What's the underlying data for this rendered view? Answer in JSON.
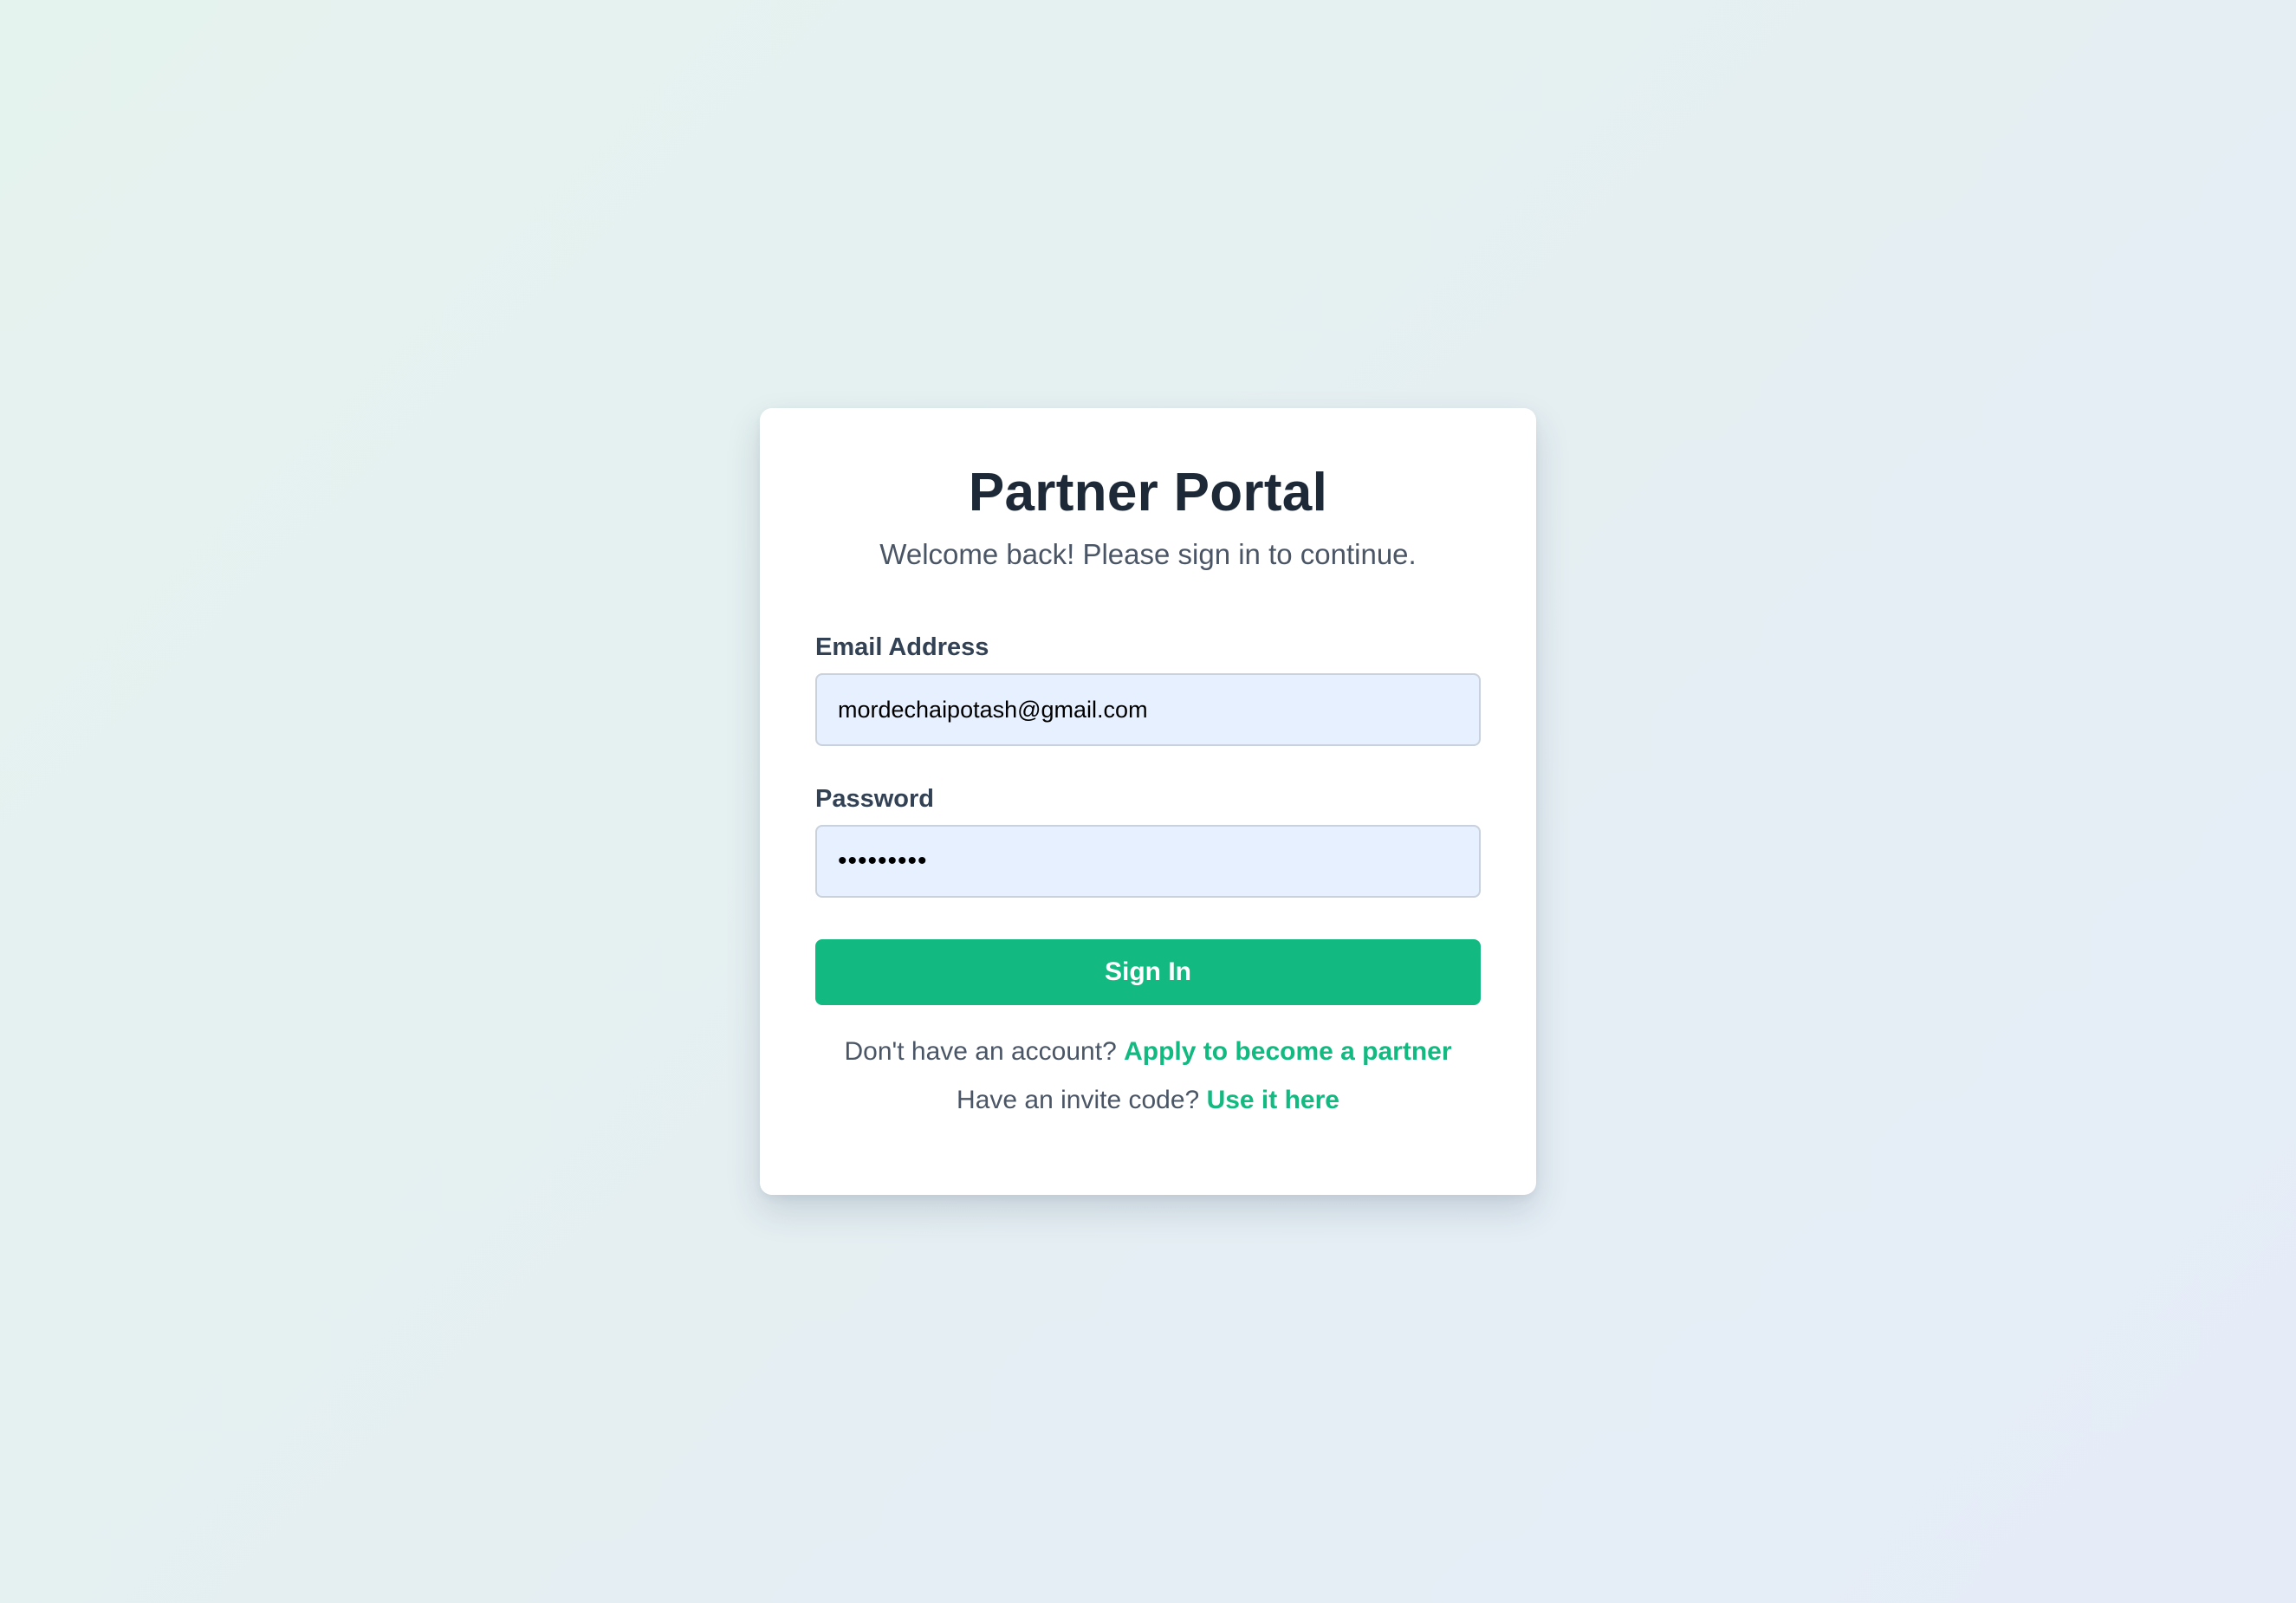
{
  "login": {
    "title": "Partner Portal",
    "subtitle": "Welcome back! Please sign in to continue.",
    "email": {
      "label": "Email Address",
      "value": "mordechaipotash@gmail.com"
    },
    "password": {
      "label": "Password",
      "masked_value": "•••••••••"
    },
    "signin_label": "Sign In",
    "apply": {
      "prompt": "Don't have an account?",
      "link": "Apply to become a partner"
    },
    "invite": {
      "prompt": "Have an invite code?",
      "link": "Use it here"
    }
  },
  "colors": {
    "accent": "#12b981",
    "title": "#1e2937",
    "input_background": "#e6f0fe"
  }
}
